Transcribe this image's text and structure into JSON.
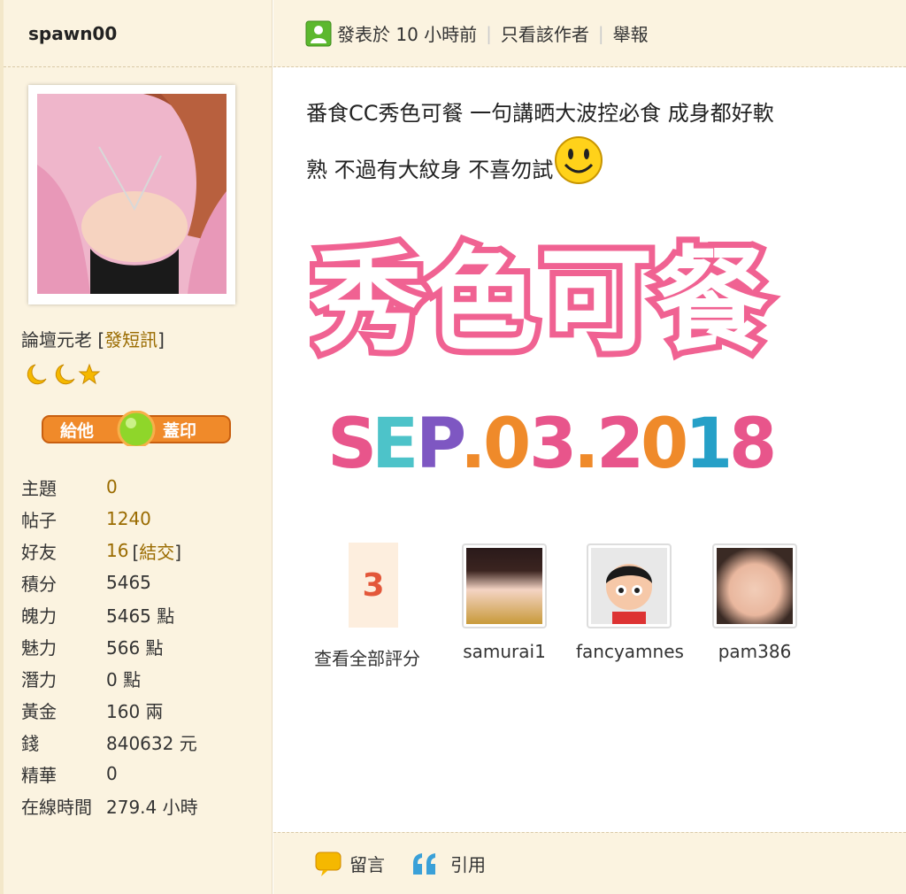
{
  "author": {
    "name": "spawn00"
  },
  "profile": {
    "rank": "論壇元老",
    "pm_link": "發短訊",
    "stamp_left": "給他",
    "stamp_right": "蓋印",
    "stats": [
      {
        "label": "主題",
        "value": "0",
        "link": true
      },
      {
        "label": "帖子",
        "value": "1240",
        "link": true
      },
      {
        "label": "好友",
        "value": "16",
        "extra": "結交",
        "link": true
      },
      {
        "label": "積分",
        "value": "5465"
      },
      {
        "label": "魄力",
        "value": "5465 點"
      },
      {
        "label": "魅力",
        "value": "566 點"
      },
      {
        "label": "潛力",
        "value": "0 點"
      },
      {
        "label": "黃金",
        "value": "160 兩"
      },
      {
        "label": "錢",
        "value": "840632 元"
      },
      {
        "label": "精華",
        "value": "0"
      },
      {
        "label": "在線時間",
        "value": "279.4 小時"
      }
    ]
  },
  "post_meta": {
    "posted": "發表於 10 小時前",
    "only_author": "只看該作者",
    "report": "舉報"
  },
  "post": {
    "line1": "番食CC秀色可餐  一句講晒大波控必食 成身都好軟",
    "line2": "熟  不過有大紋身 不喜勿試",
    "banner_title": "秀色可餐",
    "banner_date": "SEP.03.2018"
  },
  "rating": {
    "count": "3",
    "view_all": "查看全部評分",
    "raters": [
      {
        "name": "samurai1"
      },
      {
        "name": "fancyamnes"
      },
      {
        "name": "pam386"
      }
    ]
  },
  "actions": {
    "comment": "留言",
    "quote": "引用"
  },
  "colors": {
    "accent_link": "#9a6b00",
    "panel_bg": "#fbf3e0",
    "banner_pink": "#f06292",
    "rating_red": "#e3573a"
  }
}
